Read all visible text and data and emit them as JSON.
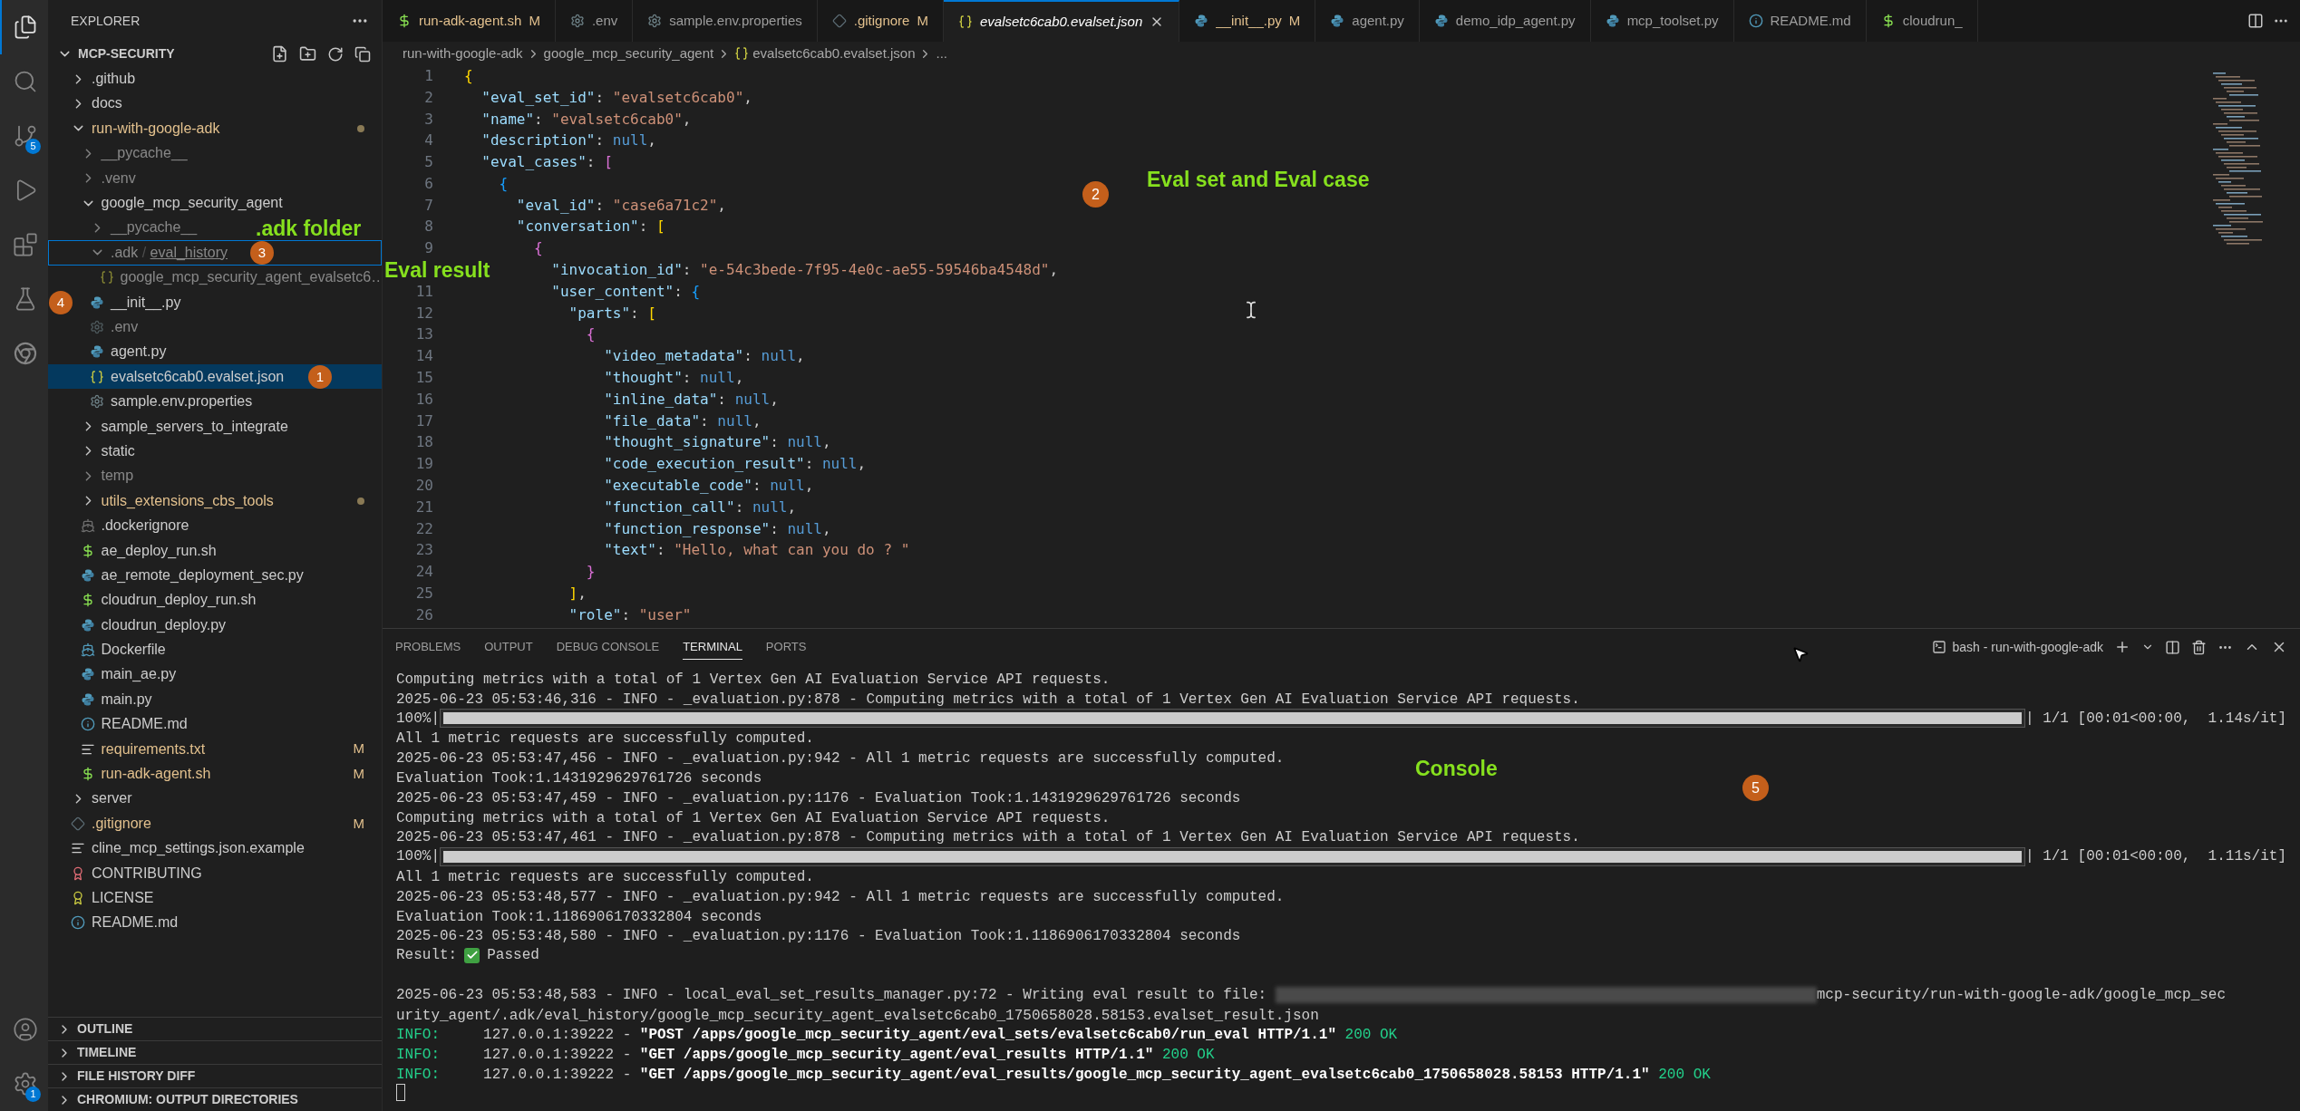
{
  "activity_bar": {
    "top": [
      {
        "kind": "files",
        "selected": true
      },
      {
        "kind": "search",
        "selected": false
      },
      {
        "kind": "source-control",
        "selected": false,
        "badge": "5"
      },
      {
        "kind": "run-debug",
        "selected": false
      },
      {
        "kind": "extensions",
        "selected": false
      },
      {
        "kind": "testing",
        "selected": false
      },
      {
        "kind": "chromium",
        "selected": false
      }
    ],
    "bottom": [
      {
        "kind": "account"
      },
      {
        "kind": "settings",
        "badge": "1"
      }
    ]
  },
  "sidebar": {
    "title": "EXPLORER",
    "root": {
      "label": "MCP-SECURITY",
      "expanded": true
    },
    "tree": [
      {
        "label": ".github",
        "kind": "folder",
        "expanded": false,
        "modified": false,
        "ignored": false,
        "selected": false,
        "focused": false
      },
      {
        "label": "docs",
        "kind": "folder",
        "expanded": false,
        "modified": false,
        "ignored": false,
        "selected": false,
        "focused": false
      },
      {
        "label": "run-with-google-adk",
        "kind": "folder",
        "expanded": true,
        "modified": true,
        "ignored": false,
        "selected": false,
        "focused": false,
        "children": [
          {
            "label": "__pycache__",
            "kind": "folder",
            "expanded": false,
            "modified": false,
            "ignored": true,
            "selected": false,
            "focused": false
          },
          {
            "label": ".venv",
            "kind": "folder",
            "expanded": false,
            "modified": false,
            "ignored": true,
            "selected": false,
            "focused": false
          },
          {
            "label": "google_mcp_security_agent",
            "kind": "folder",
            "expanded": true,
            "modified": false,
            "ignored": false,
            "selected": false,
            "focused": false,
            "children": [
              {
                "label": "__pycache__",
                "kind": "folder",
                "expanded": false,
                "modified": false,
                "ignored": true,
                "selected": false,
                "focused": false
              },
              {
                "label": ".adk",
                "separator": "/",
                "subfolder": "eval_history",
                "kind": "folder",
                "expanded": true,
                "modified": false,
                "ignored": true,
                "selected": false,
                "focused": true,
                "children": [
                  {
                    "label": "google_mcp_security_agent_evalsetc6…",
                    "kind": "json",
                    "modified": false,
                    "ignored": true,
                    "selected": false,
                    "focused": false
                  }
                ]
              },
              {
                "label": "__init__.py",
                "kind": "python",
                "modified": false,
                "ignored": false,
                "selected": false,
                "focused": false
              },
              {
                "label": ".env",
                "kind": "gear",
                "modified": false,
                "ignored": true,
                "selected": false,
                "focused": false
              },
              {
                "label": "agent.py",
                "kind": "python",
                "modified": false,
                "ignored": false,
                "selected": false,
                "focused": false
              },
              {
                "label": "evalsetc6cab0.evalset.json",
                "kind": "json",
                "modified": false,
                "ignored": false,
                "selected": true,
                "focused": false
              },
              {
                "label": "sample.env.properties",
                "kind": "gear",
                "modified": false,
                "ignored": false,
                "selected": false,
                "focused": false
              }
            ]
          },
          {
            "label": "sample_servers_to_integrate",
            "kind": "folder",
            "expanded": false,
            "modified": false,
            "ignored": false,
            "selected": false,
            "focused": false
          },
          {
            "label": "static",
            "kind": "folder",
            "expanded": false,
            "modified": false,
            "ignored": false,
            "selected": false,
            "focused": false
          },
          {
            "label": "temp",
            "kind": "folder",
            "expanded": false,
            "modified": false,
            "ignored": true,
            "selected": false,
            "focused": false
          },
          {
            "label": "utils_extensions_cbs_tools",
            "kind": "folder",
            "expanded": false,
            "modified": true,
            "ignored": false,
            "selected": false,
            "focused": false
          },
          {
            "label": ".dockerignore",
            "kind": "docker-grey",
            "modified": false,
            "ignored": false,
            "selected": false,
            "focused": false
          },
          {
            "label": "ae_deploy_run.sh",
            "kind": "shell",
            "modified": false,
            "ignored": false,
            "selected": false,
            "focused": false
          },
          {
            "label": "ae_remote_deployment_sec.py",
            "kind": "python",
            "modified": false,
            "ignored": false,
            "selected": false,
            "focused": false
          },
          {
            "label": "cloudrun_deploy_run.sh",
            "kind": "shell",
            "modified": false,
            "ignored": false,
            "selected": false,
            "focused": false
          },
          {
            "label": "cloudrun_deploy.py",
            "kind": "python",
            "modified": false,
            "ignored": false,
            "selected": false,
            "focused": false
          },
          {
            "label": "Dockerfile",
            "kind": "docker",
            "modified": false,
            "ignored": false,
            "selected": false,
            "focused": false
          },
          {
            "label": "main_ae.py",
            "kind": "python",
            "modified": false,
            "ignored": false,
            "selected": false,
            "focused": false
          },
          {
            "label": "main.py",
            "kind": "python",
            "modified": false,
            "ignored": false,
            "selected": false,
            "focused": false
          },
          {
            "label": "README.md",
            "kind": "info",
            "modified": false,
            "ignored": false,
            "selected": false,
            "focused": false
          },
          {
            "label": "requirements.txt",
            "kind": "text",
            "modified": true,
            "ignored": false,
            "badge": "M",
            "selected": false,
            "focused": false
          },
          {
            "label": "run-adk-agent.sh",
            "kind": "shell",
            "modified": true,
            "ignored": false,
            "badge": "M",
            "selected": false,
            "focused": false
          }
        ]
      },
      {
        "label": "server",
        "kind": "folder",
        "expanded": false,
        "modified": false,
        "ignored": false,
        "selected": false,
        "focused": false
      },
      {
        "label": ".gitignore",
        "kind": "git",
        "modified": true,
        "ignored": false,
        "badge": "M",
        "selected": false,
        "focused": false
      },
      {
        "label": "cline_mcp_settings.json.example",
        "kind": "text",
        "modified": false,
        "ignored": false,
        "selected": false,
        "focused": false
      },
      {
        "label": "CONTRIBUTING",
        "kind": "license-red",
        "modified": false,
        "ignored": false,
        "selected": false,
        "focused": false
      },
      {
        "label": "LICENSE",
        "kind": "license-yellow",
        "modified": false,
        "ignored": false,
        "selected": false,
        "focused": false
      },
      {
        "label": "README.md",
        "kind": "info",
        "modified": false,
        "ignored": false,
        "selected": false,
        "focused": false
      }
    ],
    "sections": [
      {
        "label": "OUTLINE",
        "expanded": false
      },
      {
        "label": "TIMELINE",
        "expanded": false
      },
      {
        "label": "FILE HISTORY DIFF",
        "expanded": false
      },
      {
        "label": "CHROMIUM: OUTPUT DIRECTORIES",
        "expanded": false
      }
    ]
  },
  "editor": {
    "tabs": [
      {
        "label": "run-adk-agent.sh",
        "kind": "shell",
        "status": "M",
        "selected": false,
        "preview": false
      },
      {
        "label": ".env",
        "kind": "gear",
        "selected": false,
        "preview": false
      },
      {
        "label": "sample.env.properties",
        "kind": "gear",
        "selected": false,
        "preview": false
      },
      {
        "label": ".gitignore",
        "kind": "git",
        "status": "M",
        "selected": false,
        "preview": false
      },
      {
        "label": "evalsetc6cab0.evalset.json",
        "kind": "json",
        "selected": true,
        "preview": true
      },
      {
        "label": "__init__.py",
        "kind": "python",
        "status": "M",
        "selected": false,
        "preview": false
      },
      {
        "label": "agent.py",
        "kind": "python",
        "selected": false,
        "preview": false
      },
      {
        "label": "demo_idp_agent.py",
        "kind": "python",
        "selected": false,
        "preview": false
      },
      {
        "label": "mcp_toolset.py",
        "kind": "python",
        "selected": false,
        "preview": false
      },
      {
        "label": "README.md",
        "kind": "info",
        "selected": false,
        "preview": false
      },
      {
        "label": "cloudrun_",
        "kind": "shell",
        "selected": false,
        "preview": false
      }
    ],
    "breadcrumb": [
      {
        "label": "run-with-google-adk"
      },
      {
        "label": "google_mcp_security_agent"
      },
      {
        "label": "evalsetc6cab0.evalset.json",
        "kind": "json"
      },
      {
        "label": "..."
      }
    ],
    "lines": [
      {
        "n": "1",
        "code": "{"
      },
      {
        "n": "2",
        "code": "  \"eval_set_id\": \"evalsetc6cab0\","
      },
      {
        "n": "3",
        "code": "  \"name\": \"evalsetc6cab0\","
      },
      {
        "n": "4",
        "code": "  \"description\": null,"
      },
      {
        "n": "5",
        "code": "  \"eval_cases\": ["
      },
      {
        "n": "6",
        "code": "    {"
      },
      {
        "n": "7",
        "code": "      \"eval_id\": \"case6a71c2\","
      },
      {
        "n": "8",
        "code": "      \"conversation\": ["
      },
      {
        "n": "9",
        "code": "        {"
      },
      {
        "code": "          \"invocation_id\": \"e-54c3bede-7f95-4e0c-ae55-59546ba4548d\","
      },
      {
        "n": "11",
        "code": "          \"user_content\": {"
      },
      {
        "n": "12",
        "code": "            \"parts\": ["
      },
      {
        "n": "13",
        "code": "              {"
      },
      {
        "n": "14",
        "code": "                \"video_metadata\": null,"
      },
      {
        "n": "15",
        "code": "                \"thought\": null,"
      },
      {
        "n": "16",
        "code": "                \"inline_data\": null,"
      },
      {
        "n": "17",
        "code": "                \"file_data\": null,"
      },
      {
        "n": "18",
        "code": "                \"thought_signature\": null,"
      },
      {
        "n": "19",
        "code": "                \"code_execution_result\": null,"
      },
      {
        "n": "20",
        "code": "                \"executable_code\": null,"
      },
      {
        "n": "21",
        "code": "                \"function_call\": null,"
      },
      {
        "n": "22",
        "code": "                \"function_response\": null,"
      },
      {
        "n": "23",
        "code": "                \"text\": \"Hello, what can you do ? \""
      },
      {
        "n": "24",
        "code": "              }"
      },
      {
        "n": "25",
        "code": "            ],"
      },
      {
        "n": "26",
        "code": "            \"role\": \"user\""
      }
    ]
  },
  "panel": {
    "tabs": [
      {
        "label": "PROBLEMS",
        "selected": false
      },
      {
        "label": "OUTPUT",
        "selected": false
      },
      {
        "label": "DEBUG CONSOLE",
        "selected": false
      },
      {
        "label": "TERMINAL",
        "selected": true
      },
      {
        "label": "PORTS",
        "selected": false
      }
    ],
    "terminal_name": "bash - run-with-google-adk",
    "lines": [
      {
        "kind": "text",
        "text": "Computing metrics with a total of 1 Vertex Gen AI Evaluation Service API requests."
      },
      {
        "kind": "text",
        "text": "2025-06-23 05:53:46,316 - INFO - _evaluation.py:878 - Computing metrics with a total of 1 Vertex Gen AI Evaluation Service API requests."
      },
      {
        "kind": "progress",
        "left": "100%|",
        "level": 1,
        "right": "| 1/1 [00:01<00:00,  1.14s/it]"
      },
      {
        "kind": "text",
        "text": "All 1 metric requests are successfully computed."
      },
      {
        "kind": "text",
        "text": "2025-06-23 05:53:47,456 - INFO - _evaluation.py:942 - All 1 metric requests are successfully computed."
      },
      {
        "kind": "text",
        "text": "Evaluation Took:1.1431929629761726 seconds"
      },
      {
        "kind": "text",
        "text": "2025-06-23 05:53:47,459 - INFO - _evaluation.py:1176 - Evaluation Took:1.1431929629761726 seconds"
      },
      {
        "kind": "text",
        "text": "Computing metrics with a total of 1 Vertex Gen AI Evaluation Service API requests."
      },
      {
        "kind": "text",
        "text": "2025-06-23 05:53:47,461 - INFO - _evaluation.py:878 - Computing metrics with a total of 1 Vertex Gen AI Evaluation Service API requests."
      },
      {
        "kind": "progress",
        "left": "100%|",
        "level": 1,
        "right": "| 1/1 [00:01<00:00,  1.11s/it]"
      },
      {
        "kind": "text",
        "text": "All 1 metric requests are successfully computed."
      },
      {
        "kind": "text",
        "text": "2025-06-23 05:53:48,577 - INFO - _evaluation.py:942 - All 1 metric requests are successfully computed."
      },
      {
        "kind": "text",
        "text": "Evaluation Took:1.1186906170332804 seconds"
      },
      {
        "kind": "text",
        "text": "2025-06-23 05:53:48,580 - INFO - _evaluation.py:1176 - Evaluation Took:1.1186906170332804 seconds"
      },
      {
        "kind": "result",
        "label": "Result:",
        "text": "Passed"
      },
      {
        "kind": "blank"
      },
      {
        "kind": "redacted",
        "before": "2025-06-23 05:53:48,583 - INFO - local_eval_set_results_manager.py:72 - Writing eval result to file: ",
        "after": "mcp-security/run-with-google-adk/google_mcp_sec"
      },
      {
        "kind": "text",
        "text": "urity_agent/.adk/eval_history/google_mcp_security_agent_evalsetc6cab0_1750658028.58153.evalset_result.json"
      },
      {
        "kind": "http",
        "tag": "INFO:",
        "client": "     127.0.0.1:39222 - ",
        "request": "\"POST /apps/google_mcp_security_agent/eval_sets/evalsetc6cab0/run_eval HTTP/1.1\"",
        "status": " 200 OK"
      },
      {
        "kind": "http",
        "tag": "INFO:",
        "client": "     127.0.0.1:39222 - ",
        "request": "\"GET /apps/google_mcp_security_agent/eval_results HTTP/1.1\"",
        "status": " 200 OK"
      },
      {
        "kind": "http",
        "tag": "INFO:",
        "client": "     127.0.0.1:39222 - ",
        "request": "\"GET /apps/google_mcp_security_agent/eval_results/google_mcp_security_agent_evalsetc6cab0_1750658028.58153 HTTP/1.1\"",
        "status": " 200 OK"
      },
      {
        "kind": "cursor"
      }
    ]
  },
  "annotations": {
    "markers": [
      {
        "number": "1"
      },
      {
        "number": "2"
      },
      {
        "number": "3"
      },
      {
        "number": "4"
      },
      {
        "number": "5"
      }
    ],
    "captions": [
      {
        "text": ".adk folder"
      },
      {
        "text": "Eval result"
      },
      {
        "text": "Eval set and Eval case"
      },
      {
        "text": "Console"
      }
    ]
  }
}
